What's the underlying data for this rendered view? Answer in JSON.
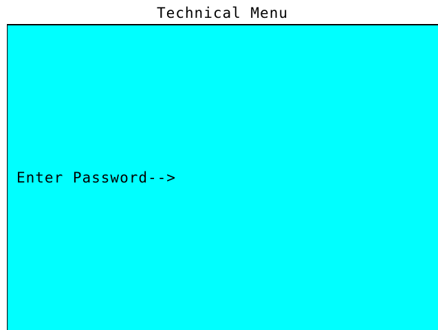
{
  "header": {
    "title": "Technical Menu"
  },
  "screen": {
    "prompt_label": "Enter Password-->",
    "background_color": "#00ffff"
  }
}
